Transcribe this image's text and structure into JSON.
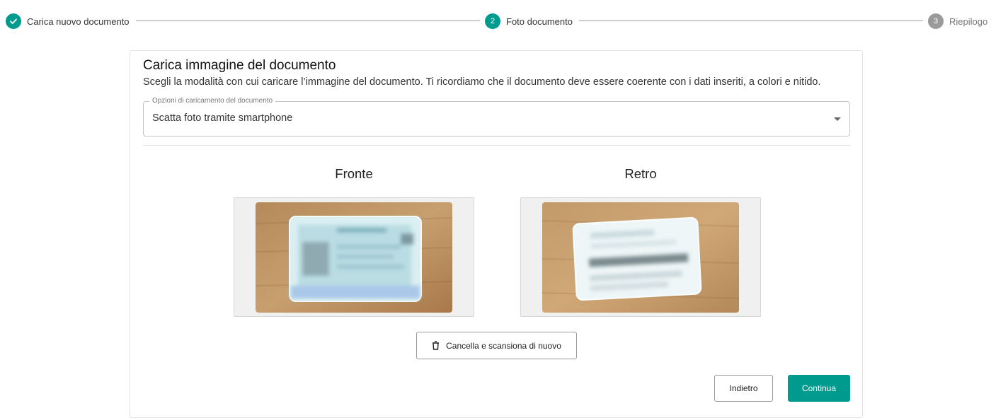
{
  "stepper": {
    "steps": [
      {
        "number": "",
        "label": "Carica nuovo documento",
        "state": "completed",
        "icon": "check-icon"
      },
      {
        "number": "2",
        "label": "Foto documento",
        "state": "active"
      },
      {
        "number": "3",
        "label": "Riepilogo",
        "state": "pending"
      }
    ]
  },
  "card": {
    "title": "Carica immagine del documento",
    "subtitle": "Scegli la modalità con cui caricare l’immagine del documento. Ti ricordiamo che il documento deve essere coerente con i dati inseriti, a colori e nitido.",
    "select": {
      "label": "Opzioni di caricamento del documento",
      "value": "Scatta foto tramite smartphone",
      "icon": "dropdown-arrow-icon"
    },
    "front": {
      "title": "Fronte"
    },
    "back": {
      "title": "Retro"
    },
    "rescan_button": {
      "label": "Cancella e scansiona di nuovo",
      "icon": "trash-icon"
    },
    "back_button": {
      "label": "Indietro"
    },
    "continue_button": {
      "label": "Continua"
    }
  },
  "colors": {
    "accent": "#009b8f",
    "pending": "#9a9a9a"
  }
}
